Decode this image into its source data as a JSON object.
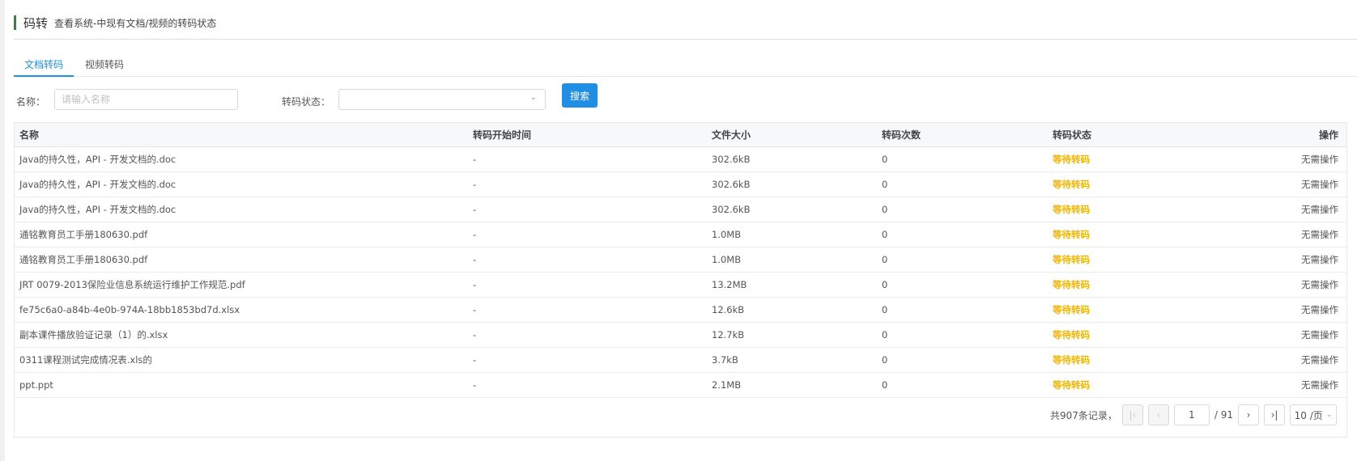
{
  "header": {
    "title": "码转",
    "subtitle": "查看系统-中现有文档/视频的转码状态"
  },
  "tabs": [
    {
      "label": "文档转码",
      "active": true
    },
    {
      "label": "视频转码",
      "active": false
    }
  ],
  "filter": {
    "name_label": "名称：",
    "name_placeholder": "请输入名称",
    "status_label": "转码状态：",
    "status_value": "",
    "search_label": "搜索"
  },
  "table": {
    "columns": [
      "名称",
      "转码开始时间",
      "文件大小",
      "转码次数",
      "转码状态",
      "操作"
    ],
    "rows": [
      {
        "name": "Java的持久性，API - 开发文档的.doc",
        "start": "-",
        "size": "302.6kB",
        "count": "0",
        "status": "等待转码",
        "action": "无需操作"
      },
      {
        "name": "Java的持久性，API - 开发文档的.doc",
        "start": "-",
        "size": "302.6kB",
        "count": "0",
        "status": "等待转码",
        "action": "无需操作"
      },
      {
        "name": "Java的持久性，API - 开发文档的.doc",
        "start": "-",
        "size": "302.6kB",
        "count": "0",
        "status": "等待转码",
        "action": "无需操作"
      },
      {
        "name": "通铭教育员工手册180630.pdf",
        "start": "-",
        "size": "1.0MB",
        "count": "0",
        "status": "等待转码",
        "action": "无需操作"
      },
      {
        "name": "通铭教育员工手册180630.pdf",
        "start": "-",
        "size": "1.0MB",
        "count": "0",
        "status": "等待转码",
        "action": "无需操作"
      },
      {
        "name": "JRT 0079-2013保险业信息系统运行维护工作规范.pdf",
        "start": "-",
        "size": "13.2MB",
        "count": "0",
        "status": "等待转码",
        "action": "无需操作"
      },
      {
        "name": "fe75c6a0-a84b-4e0b-974A-18bb1853bd7d.xlsx",
        "start": "-",
        "size": "12.6kB",
        "count": "0",
        "status": "等待转码",
        "action": "无需操作"
      },
      {
        "name": "副本课件播放验证记录（1）的.xlsx",
        "start": "-",
        "size": "12.7kB",
        "count": "0",
        "status": "等待转码",
        "action": "无需操作"
      },
      {
        "name": "0311课程测试完成情况表.xls的",
        "start": "-",
        "size": "3.7kB",
        "count": "0",
        "status": "等待转码",
        "action": "无需操作"
      },
      {
        "name": "ppt.ppt",
        "start": "-",
        "size": "2.1MB",
        "count": "0",
        "status": "等待转码",
        "action": "无需操作"
      }
    ]
  },
  "pagination": {
    "total_text": "共907条记录，",
    "current_page": "1",
    "pages_text": "/ 91",
    "page_size": "10 /页",
    "first_icon": "first-page-icon",
    "prev_icon": "chevron-left-icon",
    "next_icon": "chevron-right-icon",
    "last_icon": "last-page-icon"
  },
  "colors": {
    "accent": "#1f8fe5",
    "status_waiting": "#f5b400",
    "header_bar": "#2a8a3a"
  }
}
